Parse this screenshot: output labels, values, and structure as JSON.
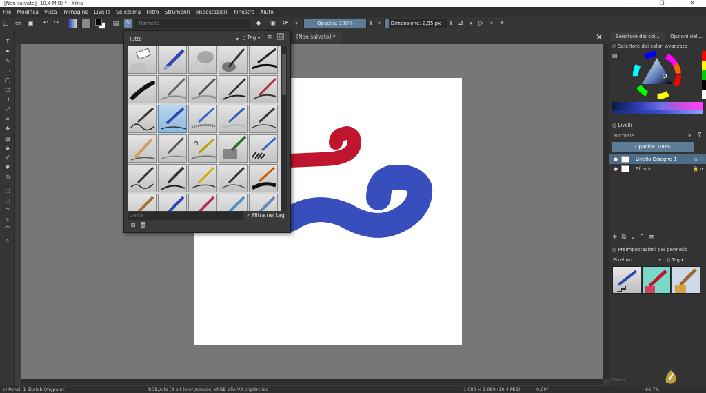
{
  "window": {
    "title": "[Non salvato] (10,4 MiB) * - Krita",
    "controls": [
      "—",
      "❐",
      "✕"
    ]
  },
  "menu": [
    "File",
    "Modifica",
    "Vista",
    "Immagine",
    "Livello",
    "Seleziona",
    "Filtro",
    "Strumenti",
    "Impostazioni",
    "Finestra",
    "Aiuto"
  ],
  "toolbar": {
    "blend_mode": "Normale",
    "opacity_label": "Opacità: 100%",
    "opacity_level": 1.0,
    "size_label": "Dimensione: 2,95 px",
    "size_level": 0.07,
    "colors": {
      "foreground": "#000000",
      "background": "#ffffff",
      "gradient_start": "#1a3fa0",
      "gradient_end": "#d0d0d0",
      "pattern": "#8a8a8a"
    },
    "icons": [
      "new-document-icon",
      "open-icon",
      "save-icon",
      "undo-icon",
      "redo-icon",
      "eraser-icon",
      "preserve-alpha-icon",
      "reload-preset-icon",
      "mirror-horizontal-icon",
      "mirror-vertical-icon",
      "wrap-around-icon"
    ]
  },
  "document_tab": {
    "label": "[Non salvato]",
    "modified": "*"
  },
  "brush_popup": {
    "filter": "Tutto",
    "tag_label": "Tag",
    "search_placeholder": "Cerca",
    "filter_in_tag": "Filtra nel tag",
    "filter_checked": true
  },
  "dock": {
    "tabs": [
      "Selettore dei col...",
      "Opzioni dell..."
    ],
    "color_selector_title": "Selettore dei colori avanzato",
    "layers_title": "Livelli",
    "blend_mode": "Normale",
    "layer_opacity": "Opacità: 100%",
    "layers": [
      {
        "name": "Livello Disegno 1",
        "active": true
      },
      {
        "name": "Sfondo",
        "active": false
      }
    ],
    "presets_title": "Preimpostazioni del pennello",
    "preset_tag": "Pixel Art",
    "tag_label": "Tag",
    "search_placeholder": "Cerca"
  },
  "status": {
    "brush": "c) Pencil-1 Sketch (mypaint)",
    "colorspace": "RGB/Alfa (8-bit interi/canale)  sRGB-elle-V2-srgbtrc.icc",
    "image_size": "1.080 × 1.080 (10,4 MiB)",
    "rotation": "0,00°",
    "zoom": "66,7%"
  },
  "colors": {
    "accent": "#5d7c98",
    "red_stroke": "#c0152f",
    "blue_stroke": "#2d44b8"
  }
}
